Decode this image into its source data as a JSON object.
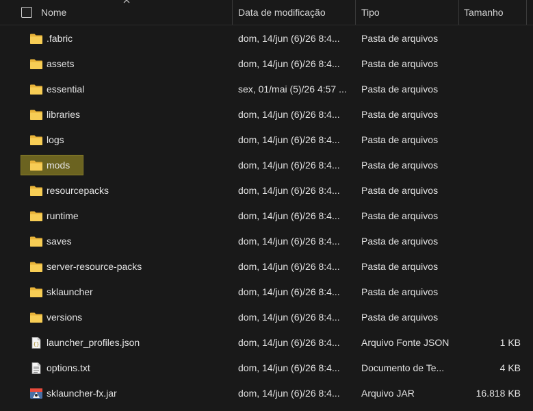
{
  "columns": {
    "name": "Nome",
    "date": "Data de modificação",
    "type": "Tipo",
    "size": "Tamanho"
  },
  "rows": [
    {
      "name": ".fabric",
      "date": "dom, 14/jun (6)/26 8:4...",
      "type": "Pasta de arquivos",
      "size": "",
      "icon": "folder-icon"
    },
    {
      "name": "assets",
      "date": "dom, 14/jun (6)/26 8:4...",
      "type": "Pasta de arquivos",
      "size": "",
      "icon": "folder-icon"
    },
    {
      "name": "essential",
      "date": "sex, 01/mai (5)/26 4:57 ...",
      "type": "Pasta de arquivos",
      "size": "",
      "icon": "folder-icon"
    },
    {
      "name": "libraries",
      "date": "dom, 14/jun (6)/26 8:4...",
      "type": "Pasta de arquivos",
      "size": "",
      "icon": "folder-icon"
    },
    {
      "name": "logs",
      "date": "dom, 14/jun (6)/26 8:4...",
      "type": "Pasta de arquivos",
      "size": "",
      "icon": "folder-icon"
    },
    {
      "name": "mods",
      "date": "dom, 14/jun (6)/26 8:4...",
      "type": "Pasta de arquivos",
      "size": "",
      "icon": "folder-icon",
      "highlighted": true
    },
    {
      "name": "resourcepacks",
      "date": "dom, 14/jun (6)/26 8:4...",
      "type": "Pasta de arquivos",
      "size": "",
      "icon": "folder-icon"
    },
    {
      "name": "runtime",
      "date": "dom, 14/jun (6)/26 8:4...",
      "type": "Pasta de arquivos",
      "size": "",
      "icon": "folder-icon"
    },
    {
      "name": "saves",
      "date": "dom, 14/jun (6)/26 8:4...",
      "type": "Pasta de arquivos",
      "size": "",
      "icon": "folder-icon"
    },
    {
      "name": "server-resource-packs",
      "date": "dom, 14/jun (6)/26 8:4...",
      "type": "Pasta de arquivos",
      "size": "",
      "icon": "folder-icon"
    },
    {
      "name": "sklauncher",
      "date": "dom, 14/jun (6)/26 8:4...",
      "type": "Pasta de arquivos",
      "size": "",
      "icon": "folder-icon"
    },
    {
      "name": "versions",
      "date": "dom, 14/jun (6)/26 8:4...",
      "type": "Pasta de arquivos",
      "size": "",
      "icon": "folder-icon"
    },
    {
      "name": "launcher_profiles.json",
      "date": "dom, 14/jun (6)/26 8:4...",
      "type": "Arquivo Fonte JSON",
      "size": "1 KB",
      "icon": "json-file-icon"
    },
    {
      "name": "options.txt",
      "date": "dom, 14/jun (6)/26 8:4...",
      "type": "Documento de Te...",
      "size": "4 KB",
      "icon": "text-file-icon"
    },
    {
      "name": "sklauncher-fx.jar",
      "date": "dom, 14/jun (6)/26 8:4...",
      "type": "Arquivo JAR",
      "size": "16.818 KB",
      "icon": "jar-file-icon"
    }
  ],
  "colors": {
    "background": "#191919",
    "folder": "#f4c84a",
    "highlight": "#6b6320"
  }
}
